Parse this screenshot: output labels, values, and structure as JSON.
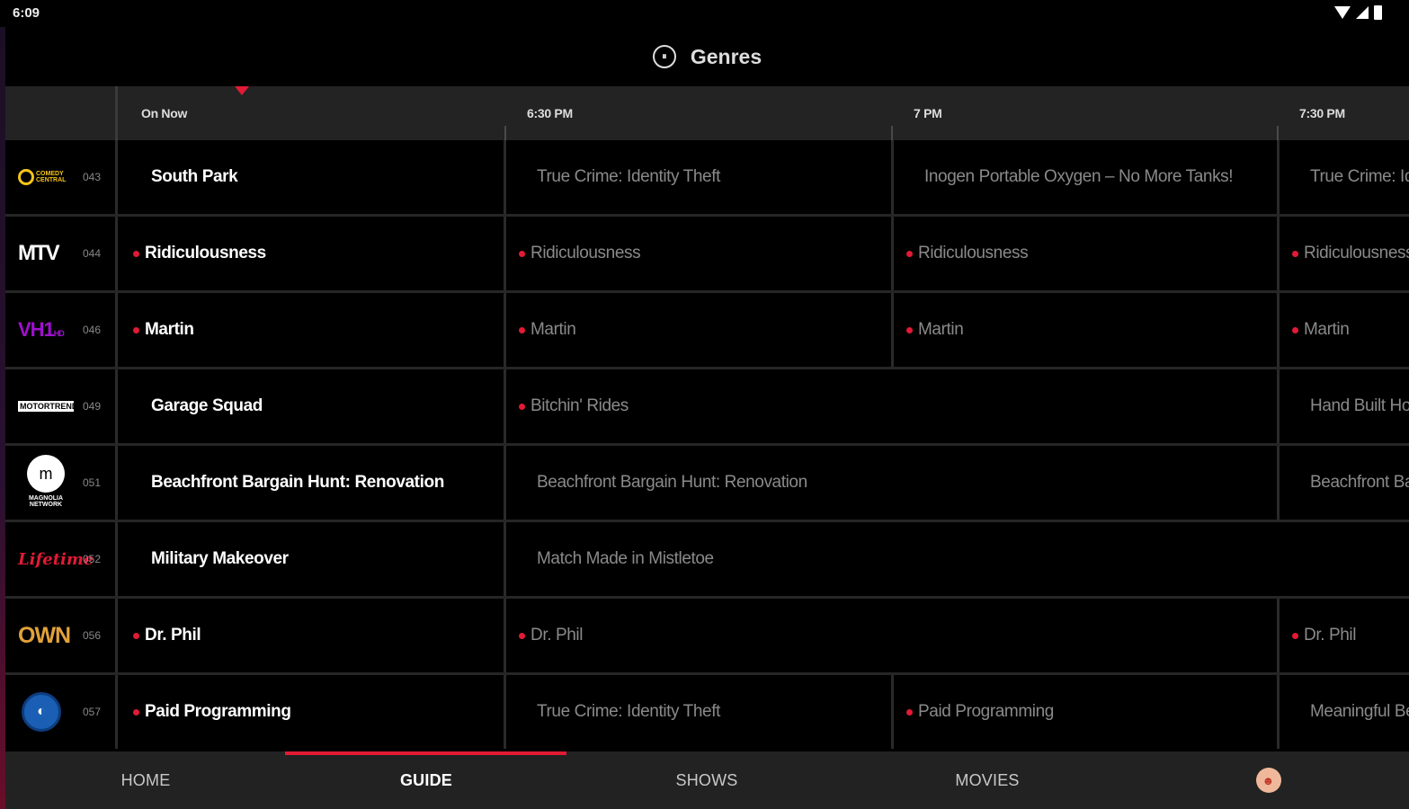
{
  "status_bar": {
    "time": "6:09"
  },
  "header": {
    "title": "Genres"
  },
  "timeline": {
    "labels": [
      "On Now",
      "6:30 PM",
      "7 PM",
      "7:30 PM"
    ]
  },
  "rows": [
    {
      "channel": {
        "logo": "comedy-central-logo",
        "logo_text": "COMEDY CENTRAL",
        "number": "043"
      },
      "programs": [
        {
          "title": "South Park",
          "new": false
        },
        {
          "title": "True Crime: Identity Theft",
          "new": false
        },
        {
          "title": "Inogen Portable Oxygen – No More Tanks!",
          "new": false
        },
        {
          "title": "True Crime: Identity Theft",
          "new": false
        }
      ]
    },
    {
      "channel": {
        "logo": "mtv-logo",
        "logo_text": "MTV",
        "number": "044"
      },
      "programs": [
        {
          "title": "Ridiculousness",
          "new": true
        },
        {
          "title": "Ridiculousness",
          "new": true
        },
        {
          "title": "Ridiculousness",
          "new": true
        },
        {
          "title": "Ridiculousness",
          "new": true
        }
      ]
    },
    {
      "channel": {
        "logo": "vh1-logo",
        "logo_text": "VH1",
        "logo_sub": "HD",
        "number": "046"
      },
      "programs": [
        {
          "title": "Martin",
          "new": true
        },
        {
          "title": "Martin",
          "new": true
        },
        {
          "title": "Martin",
          "new": true
        },
        {
          "title": "Martin",
          "new": true
        }
      ]
    },
    {
      "channel": {
        "logo": "motortrend-logo",
        "logo_text": "MOTORTREND",
        "number": "049"
      },
      "programs": [
        {
          "title": "Garage Squad",
          "new": false
        },
        {
          "title": "Bitchin' Rides",
          "new": true
        },
        {
          "title": "Hand Built Hot Rods",
          "new": false
        }
      ]
    },
    {
      "channel": {
        "logo": "magnolia-network-logo",
        "logo_text": "m",
        "logo_sub": "MAGNOLIA NETWORK",
        "number": "051"
      },
      "programs": [
        {
          "title": "Beachfront Bargain Hunt: Renovation",
          "new": false
        },
        {
          "title": "Beachfront Bargain Hunt: Renovation",
          "new": false
        },
        {
          "title": "Beachfront Bargain Hunt",
          "new": false
        }
      ]
    },
    {
      "channel": {
        "logo": "lifetime-logo",
        "logo_text": "Lifetime",
        "number": "052"
      },
      "programs": [
        {
          "title": "Military Makeover",
          "new": false
        },
        {
          "title": "Match Made in Mistletoe",
          "new": false
        }
      ]
    },
    {
      "channel": {
        "logo": "own-logo",
        "logo_text": "OWN",
        "number": "056"
      },
      "programs": [
        {
          "title": "Dr. Phil",
          "new": true
        },
        {
          "title": "Dr. Phil",
          "new": true
        },
        {
          "title": "Dr. Phil",
          "new": true
        }
      ]
    },
    {
      "channel": {
        "logo": "globe-channel-logo",
        "logo_text": "",
        "number": "057"
      },
      "programs": [
        {
          "title": "Paid Programming",
          "new": true
        },
        {
          "title": "True Crime: Identity Theft",
          "new": false
        },
        {
          "title": "Paid Programming",
          "new": true
        },
        {
          "title": "Meaningful Beauty",
          "new": false
        }
      ]
    }
  ],
  "bottom_nav": {
    "items": [
      {
        "label": "HOME",
        "active": false
      },
      {
        "label": "GUIDE",
        "active": true
      },
      {
        "label": "SHOWS",
        "active": false
      },
      {
        "label": "MOVIES",
        "active": false
      }
    ],
    "avatar_icon": "profile-avatar-icon"
  },
  "colors": {
    "accent": "#e21a35",
    "background": "#000000",
    "nav_background": "#222222",
    "timebar_background": "#232323"
  }
}
